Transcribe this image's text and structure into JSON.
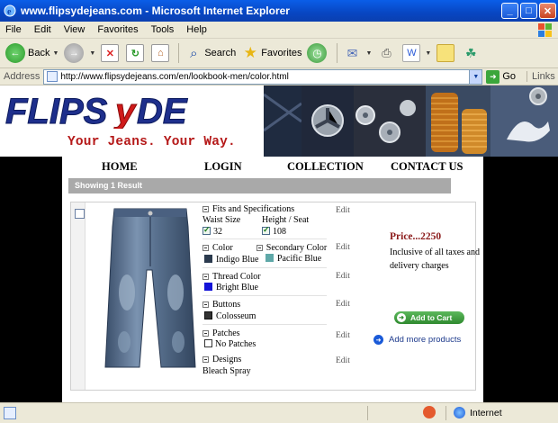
{
  "window": {
    "title": "www.flipsydejeans.com - Microsoft Internet Explorer"
  },
  "menu": [
    "File",
    "Edit",
    "View",
    "Favorites",
    "Tools",
    "Help"
  ],
  "toolbar": {
    "back": "Back",
    "search": "Search",
    "favorites": "Favorites"
  },
  "address": {
    "label": "Address",
    "url": "http://www.flipsydejeans.com/en/lookbook-men/color.html",
    "go": "Go",
    "links": "Links"
  },
  "site": {
    "tagline": "Your Jeans. Your Way.",
    "nav": [
      "HOME",
      "LOGIN",
      "COLLECTION",
      "CONTACT US"
    ],
    "results": "Showing 1 Result"
  },
  "product": {
    "specs": {
      "fits_title": "Fits and Specifications",
      "waist_label": "Waist Size",
      "waist_value": "32",
      "height_label": "Height / Seat",
      "height_value": "108",
      "color_title": "Color",
      "color_value": "Indigo Blue",
      "color_hex": "#2b3a4e",
      "secondary_title": "Secondary Color",
      "secondary_value": "Pacific Blue",
      "secondary_hex": "#5fa8a8",
      "thread_title": "Thread Color",
      "thread_value": "Bright Blue",
      "thread_hex": "#1414d8",
      "buttons_title": "Buttons",
      "buttons_value": "Colosseum",
      "patches_title": "Patches",
      "patches_value": "No Patches",
      "designs_title": "Designs",
      "designs_value": "Bleach Spray",
      "edit": "Edit"
    },
    "price": "Price...2250",
    "tax_note": "Inclusive of all taxes and delivery charges",
    "add_to_cart": "Add to Cart",
    "add_more": "Add more products"
  },
  "status": {
    "zone": "Internet"
  }
}
